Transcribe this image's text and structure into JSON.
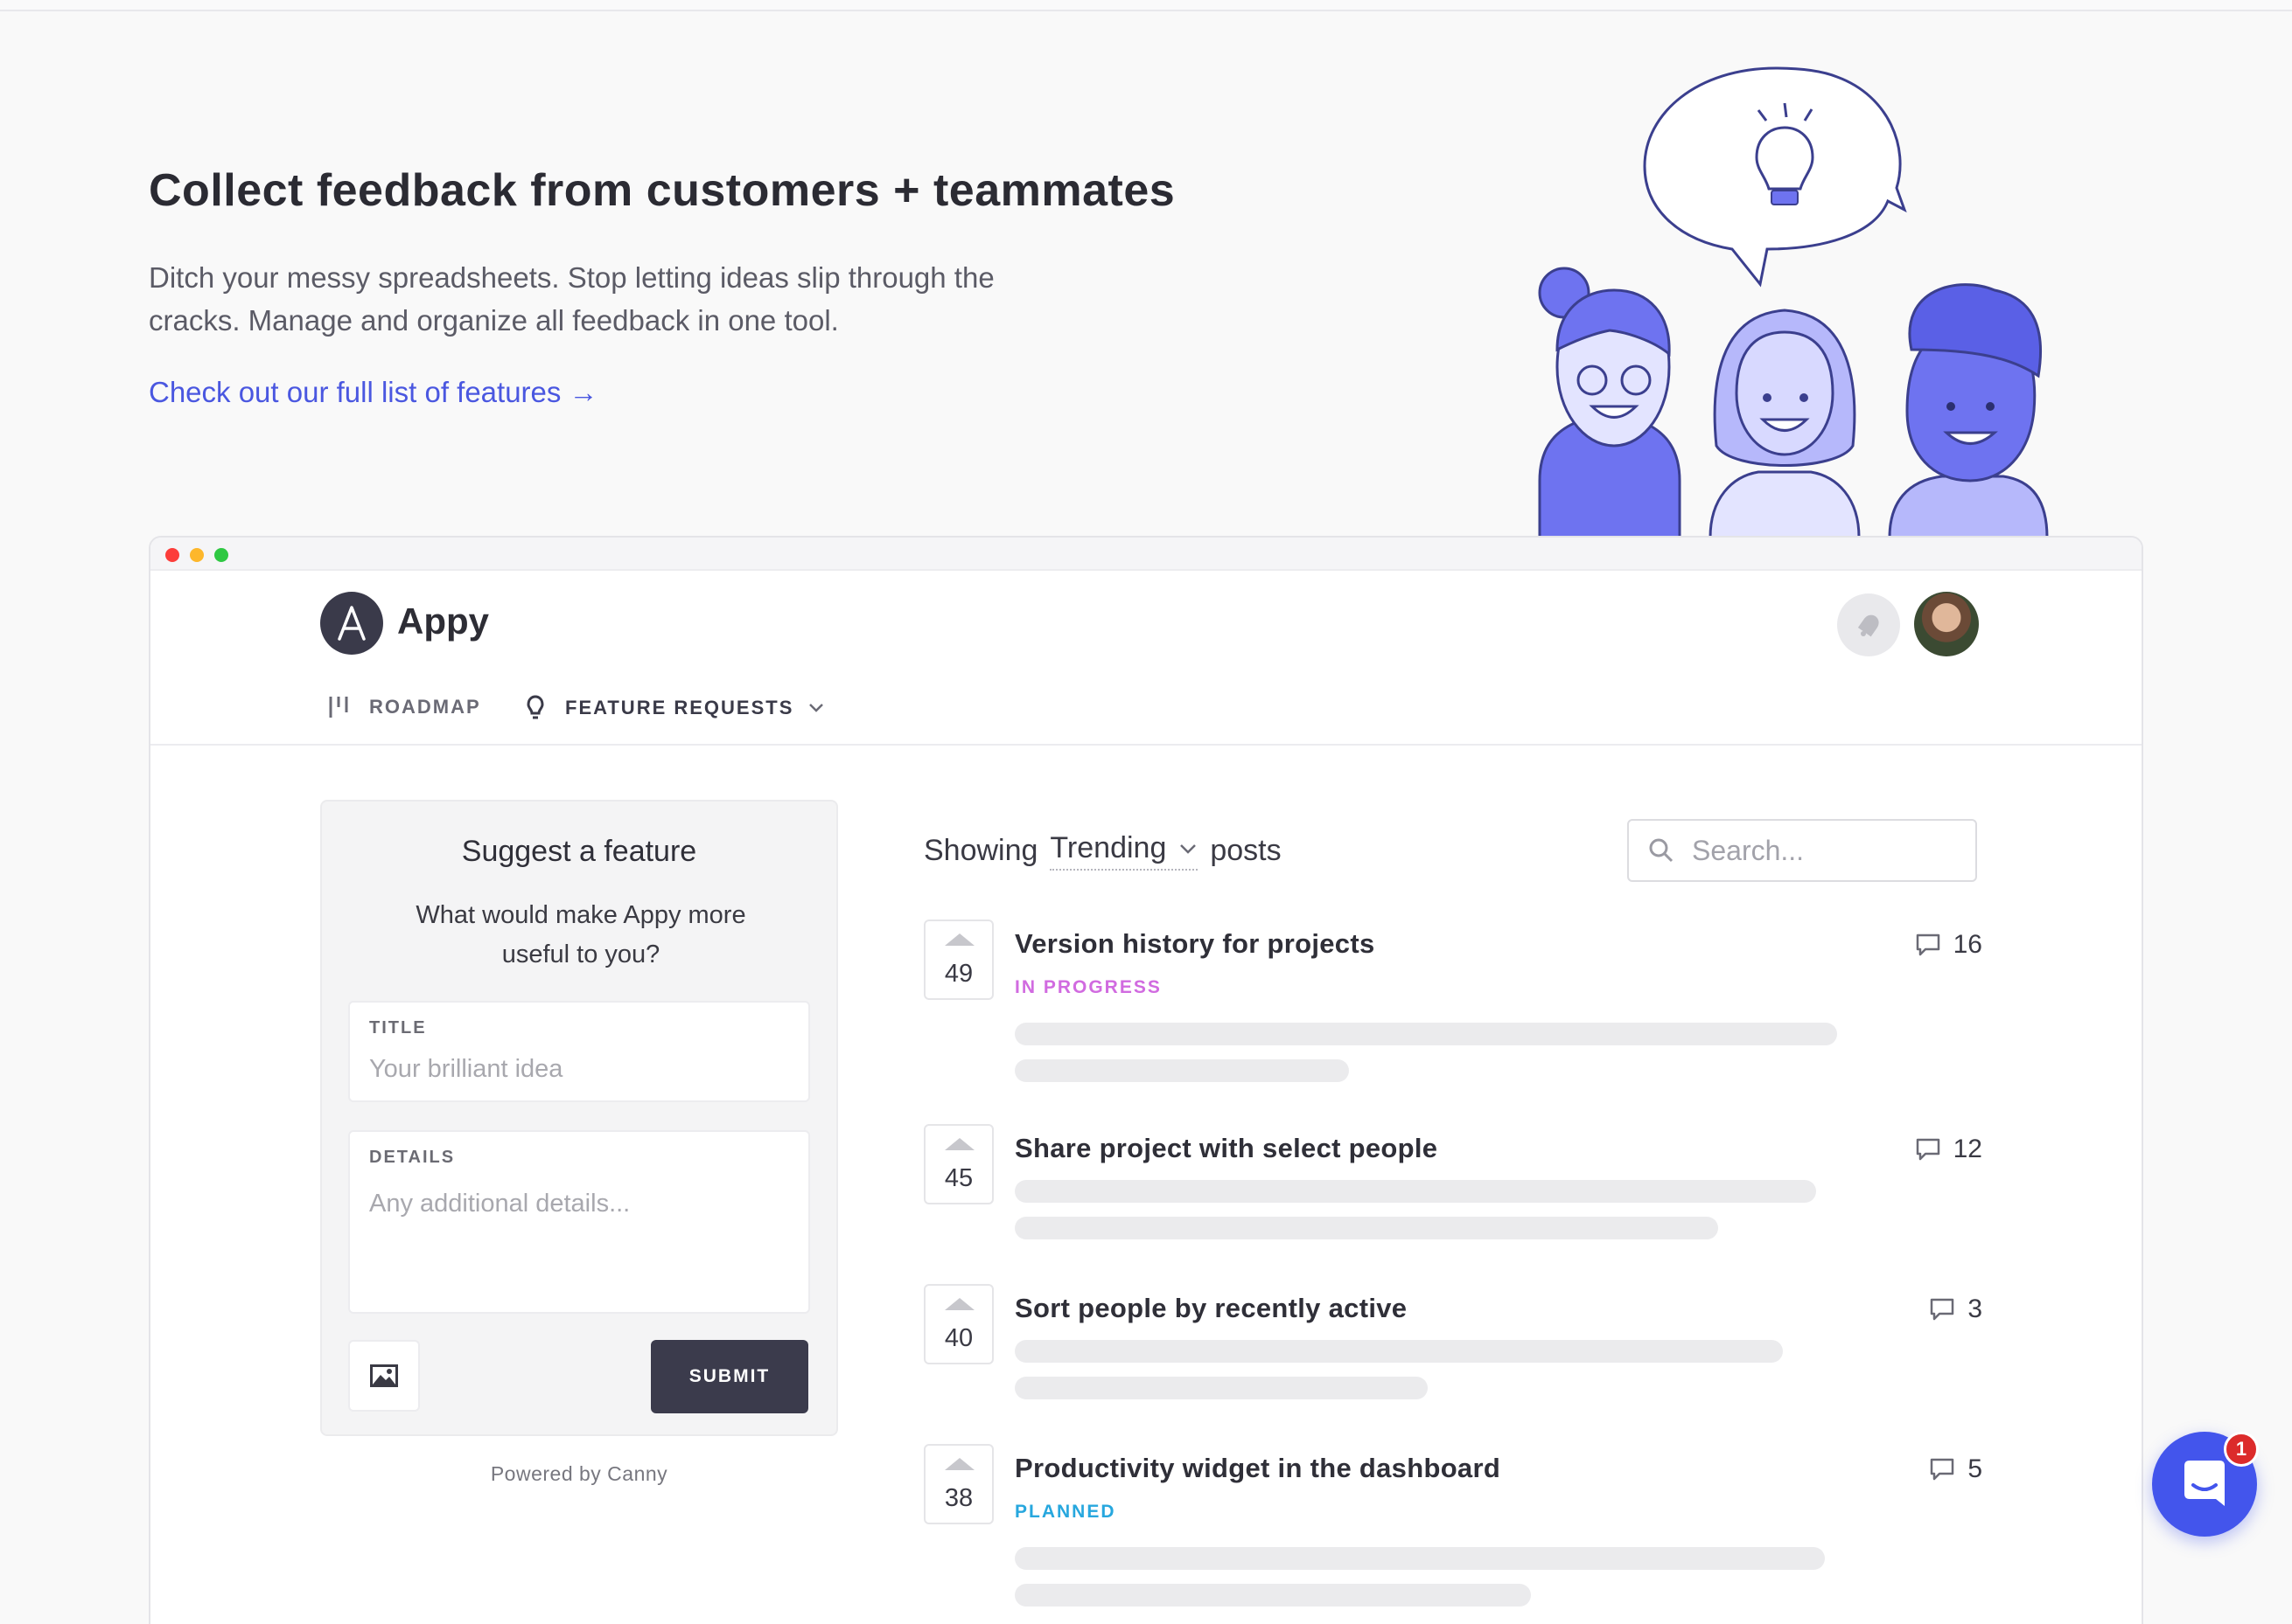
{
  "hero": {
    "title": "Collect feedback from customers + teammates",
    "description": "Ditch your messy spreadsheets. Stop letting ideas slip through the cracks. Manage and organize all feedback in one tool.",
    "link": "Check out our full list of features →"
  },
  "app": {
    "name": "Appy",
    "logo_letter": "A",
    "nav": {
      "roadmap": "ROADMAP",
      "feature_requests": "FEATURE REQUESTS"
    }
  },
  "suggest": {
    "title": "Suggest a feature",
    "subtitle": "What would make Appy more useful to you?",
    "title_label": "TITLE",
    "title_placeholder": "Your brilliant idea",
    "details_label": "DETAILS",
    "details_placeholder": "Any additional details...",
    "submit": "SUBMIT",
    "powered_by": "Powered by Canny"
  },
  "list": {
    "showing": "Showing",
    "sort": "Trending",
    "posts_word": "posts",
    "search_placeholder": "Search..."
  },
  "posts": [
    {
      "votes": "49",
      "title": "Version history for projects",
      "status": "IN PROGRESS",
      "comments": "16"
    },
    {
      "votes": "45",
      "title": "Share project with select people",
      "status": "",
      "comments": "12"
    },
    {
      "votes": "40",
      "title": "Sort people by recently active",
      "status": "",
      "comments": "3"
    },
    {
      "votes": "38",
      "title": "Productivity widget in the dashboard",
      "status": "PLANNED",
      "comments": "5"
    }
  ],
  "chat": {
    "badge": "1"
  },
  "colors": {
    "accent": "#4a57e0",
    "in_progress": "#d16be0",
    "planned": "#27a7de",
    "submit_bg": "#3b3b4c",
    "chat": "#4355ec"
  },
  "icons": [
    "lightbulb-icon",
    "roadmap-icon",
    "chevron-down-icon",
    "search-icon",
    "comment-icon",
    "image-icon",
    "bell-icon",
    "chat-icon"
  ]
}
